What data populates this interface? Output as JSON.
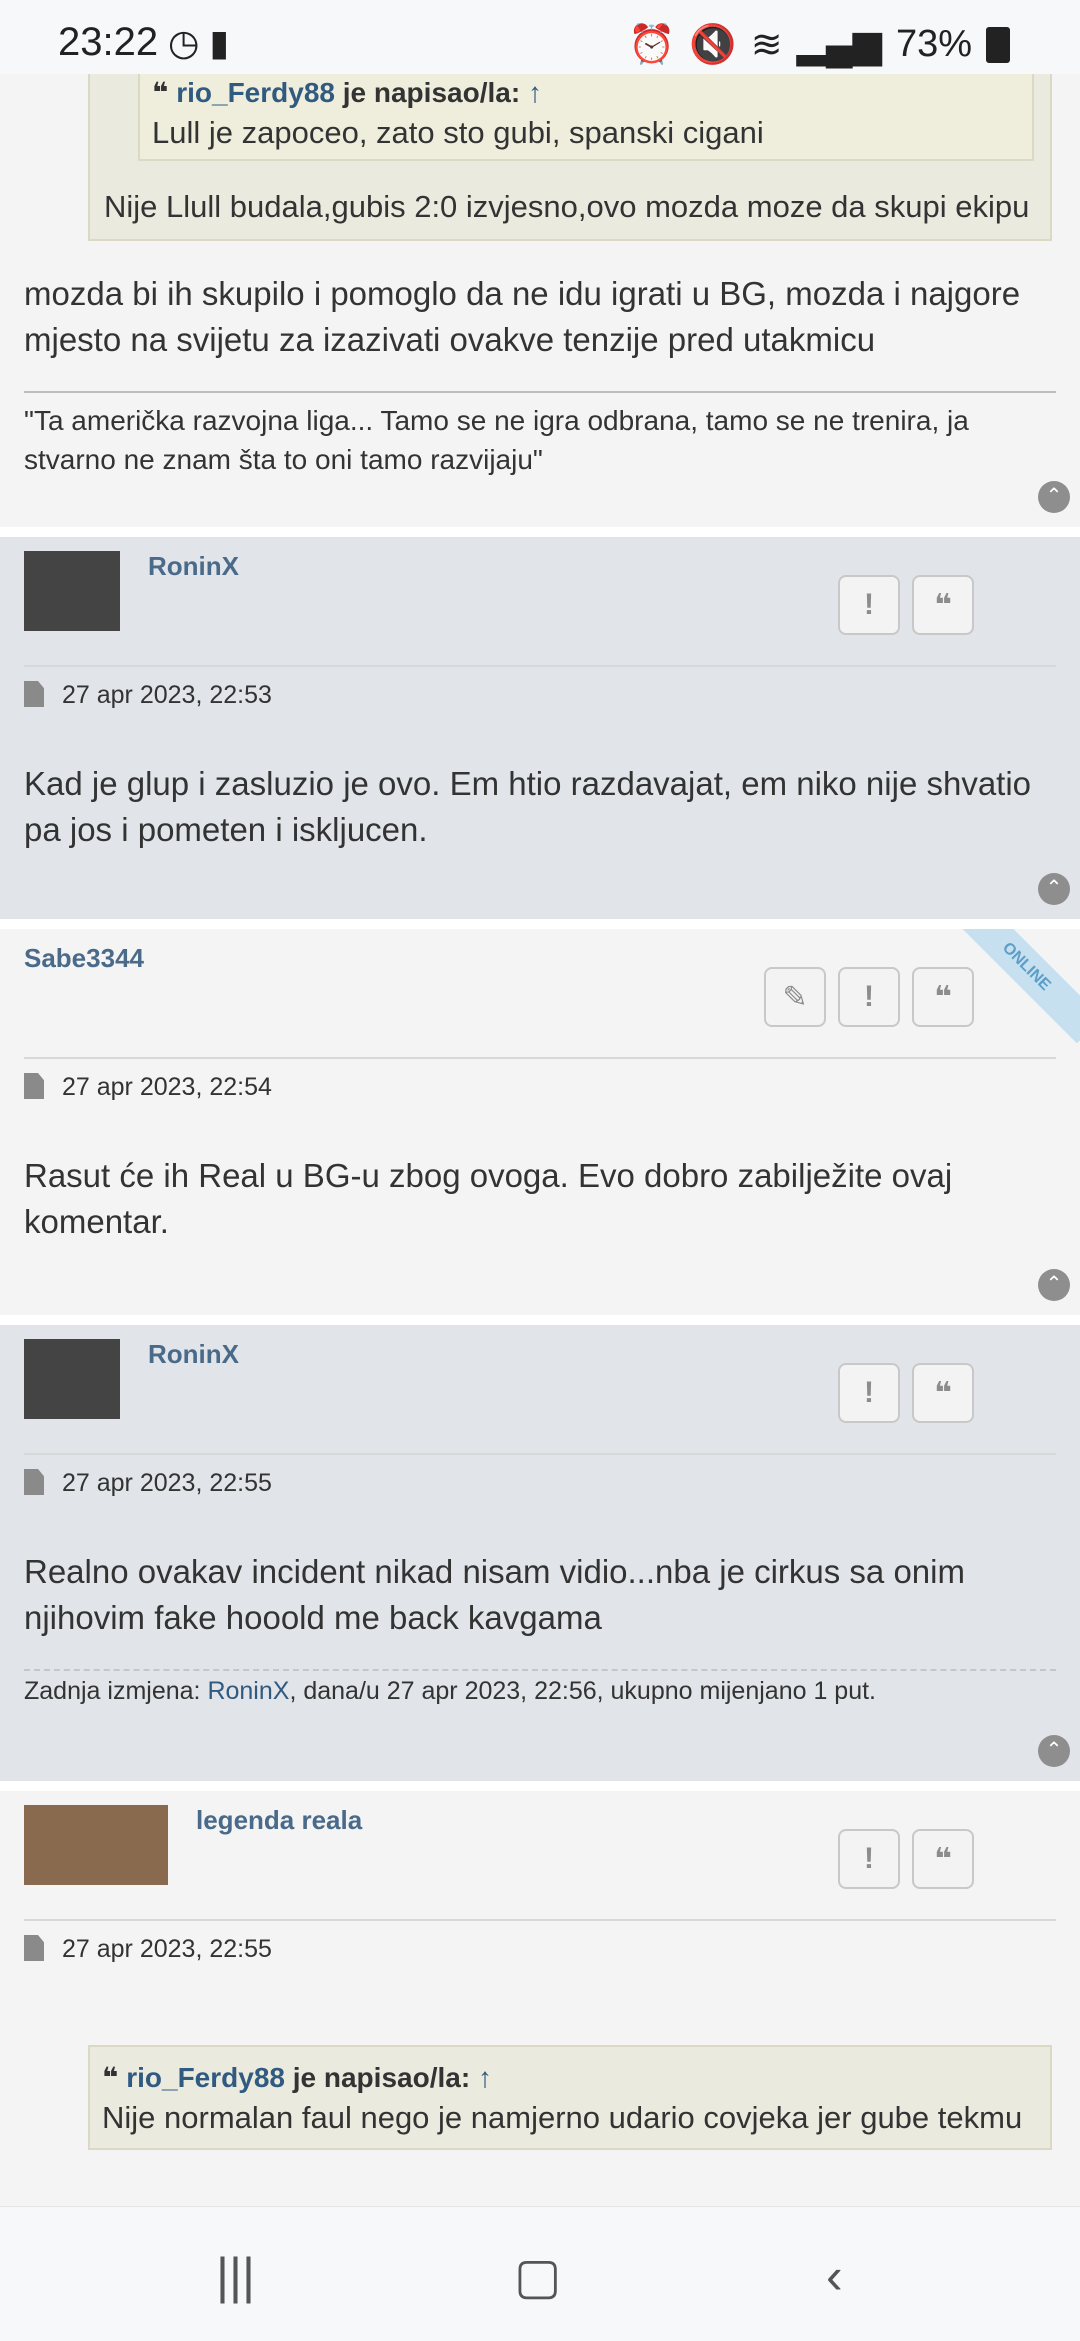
{
  "status_bar": {
    "time": "23:22",
    "battery": "73%"
  },
  "posts": [
    {
      "quote_nested": {
        "author": "rio_Ferdy88",
        "wrote": "je napisao/la:",
        "text": "Lull je zapoceo, zato sto gubi, spanski cigani"
      },
      "quote_outer_text": "Nije Llull budala,gubis 2:0 izvjesno,ovo mozda moze da skupi ekipu",
      "text": "mozda bi ih skupilo i pomoglo da ne idu igrati u BG, mozda i najgore mjesto na svijetu za izazivati ovakve tenzije pred utakmicu",
      "signature": "\"Ta američka razvojna liga... Tamo se ne igra odbrana, tamo se ne trenira, ja stvarno ne znam šta to oni tamo razvijaju\""
    },
    {
      "username": "RoninX",
      "date": "27 apr 2023, 22:53",
      "text": "Kad je glup i zasluzio je ovo. Em htio razdavajat, em niko nije shvatio pa jos i pometen i iskljucen."
    },
    {
      "username": "Sabe3344",
      "badge": "ONLINE",
      "date": "27 apr 2023, 22:54",
      "text": "Rasut će ih Real u BG-u zbog ovoga. Evo dobro zabilježite ovaj komentar."
    },
    {
      "username": "RoninX",
      "date": "27 apr 2023, 22:55",
      "text": "Realno ovakav incident nikad nisam vidio...nba je cirkus sa onim njihovim fake hooold me back kavgama",
      "edit": {
        "prefix": "Zadnja izmjena: ",
        "user": "RoninX",
        "suffix": ", dana/u 27 apr 2023, 22:56, ukupno mijenjano 1 put."
      }
    },
    {
      "username": "legenda reala",
      "date": "27 apr 2023, 22:55",
      "quote": {
        "author": "rio_Ferdy88",
        "wrote": "je napisao/la:",
        "text": "Nije normalan faul nego je namjerno udario covjeka jer gube tekmu"
      }
    }
  ]
}
